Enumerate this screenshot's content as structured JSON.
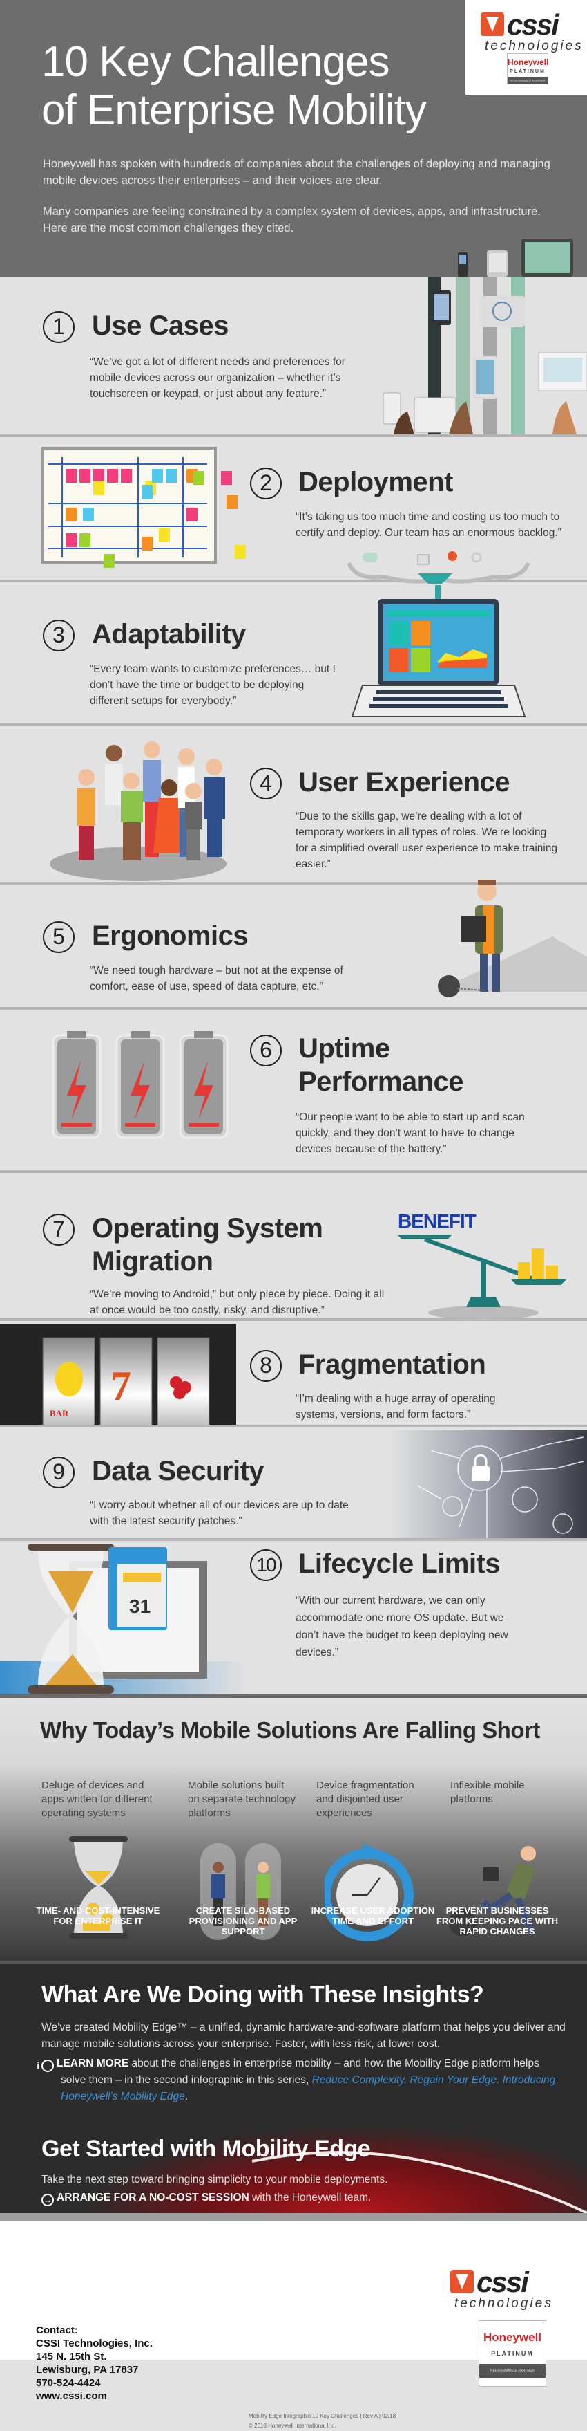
{
  "header": {
    "title_line1": "10 Key Challenges",
    "title_line2": "of Enterprise Mobility",
    "intro1": "Honeywell has spoken with hundreds of companies about the challenges of deploying and managing mobile devices across their enterprises – and their voices are clear.",
    "intro2": "Many companies are feeling constrained by a complex system of devices, apps, and infrastructure. Here are the most common challenges they cited."
  },
  "logo": {
    "word": "cssi",
    "sub": "technologies",
    "badge_brand": "Honeywell",
    "badge_level": "PLATINUM",
    "badge_sub": "PERFORMANCE PARTNER"
  },
  "challenges": [
    {
      "num": "1",
      "title": "Use Cases",
      "quote": "“We’ve got a lot of different needs and preferences for mobile devices across our organization – whether it’s touchscreen or keypad, or just about any feature.”"
    },
    {
      "num": "2",
      "title": "Deployment",
      "quote": "“It’s taking us too much time and costing us too much to certify and deploy. Our team has an enormous backlog.”"
    },
    {
      "num": "3",
      "title": "Adaptability",
      "quote": "“Every team wants to customize preferences… but I don’t have the time or budget to be deploying different setups for everybody.”"
    },
    {
      "num": "4",
      "title": "User Experience",
      "quote": "“Due to the skills gap, we’re dealing with a lot of temporary workers in all types of roles. We’re looking for a simplified overall user experience to make training easier.”"
    },
    {
      "num": "5",
      "title": "Ergonomics",
      "quote": "“We need tough hardware – but not at the expense of comfort, ease of use, speed of data capture, etc.”"
    },
    {
      "num": "6",
      "title": "Uptime Performance",
      "quote": "“Our people want to be able to start up and scan quickly, and they don’t want to have to change devices because of the battery.”"
    },
    {
      "num": "7",
      "title": "Operating System Migration",
      "quote": "“We’re moving to Android,” but only piece by piece. Doing it all at once would be too costly, risky, and disruptive.”"
    },
    {
      "num": "8",
      "title": "Fragmentation",
      "quote": "“I’m dealing with a huge array of operating systems, versions, and form factors.”"
    },
    {
      "num": "9",
      "title": "Data Security",
      "quote": "“I worry about whether all of our devices are up to date with the latest security patches.”"
    },
    {
      "num": "10",
      "title": "Lifecycle Limits",
      "quote": "“With our current hardware, we can only accommodate one more OS update. But we don’t have the budget to keep deploying new devices.”"
    }
  ],
  "illustrations": {
    "benefit_label": "BENEFIT",
    "calendar_day": "31",
    "slot_bar": "BAR"
  },
  "why": {
    "title": "Why Today’s Mobile Solutions Are Falling Short",
    "columns": [
      {
        "problem": "Deluge of devices and apps written for different operating systems",
        "effect": "TIME- AND COST-INTENSIVE FOR ENTERPRISE IT"
      },
      {
        "problem": "Mobile solutions built on separate technology platforms",
        "effect": "CREATE SILO-BASED PROVISIONING AND APP SUPPORT"
      },
      {
        "problem": "Device fragmentation and disjointed user experiences",
        "effect": "INCREASE USER ADOPTION TIME AND EFFORT"
      },
      {
        "problem": "Inflexible mobile platforms",
        "effect": "PREVENT BUSINESSES FROM KEEPING PACE WITH RAPID CHANGES"
      }
    ]
  },
  "insights": {
    "title": "What Are We Doing with These Insights?",
    "body": "We’ve created Mobility Edge™ – a unified, dynamic hardware-and-software platform that helps you deliver and manage mobile solutions across your enterprise. Faster, with less risk, at lower cost.",
    "learn_more_label": "LEARN MORE",
    "learn_more_text": "about the challenges in enterprise mobility – and how the Mobility Edge platform helps solve them – in the second infographic in this series,",
    "learn_more_link": "Reduce Complexity. Regain Your Edge. Introducing Honeywell’s Mobility Edge",
    "get_started_title": "Get Started with Mobility Edge",
    "get_started_body": "Take the next step toward bringing simplicity to your mobile deployments.",
    "arrange_label": "ARRANGE FOR A NO-COST SESSION",
    "arrange_text": "with the Honeywell team."
  },
  "footer": {
    "contact_label": "Contact:",
    "company": "CSSI Technologies, Inc.",
    "street": "145 N. 15th St.",
    "city": "Lewisburg, PA 17837",
    "phone": "570-524-4424",
    "web": "www.cssi.com",
    "doc_line": "Mobility Edge Infographic 10 Key Challenges | Rev A | 02/18",
    "copyright": "© 2018 Honeywell International Inc."
  },
  "colors": {
    "header_bg": "#6d6d6d",
    "section_bg": "#e2e2e2",
    "accent_red": "#d7262c",
    "cssi_orange": "#e8532a",
    "link_blue": "#3b8fd6"
  }
}
